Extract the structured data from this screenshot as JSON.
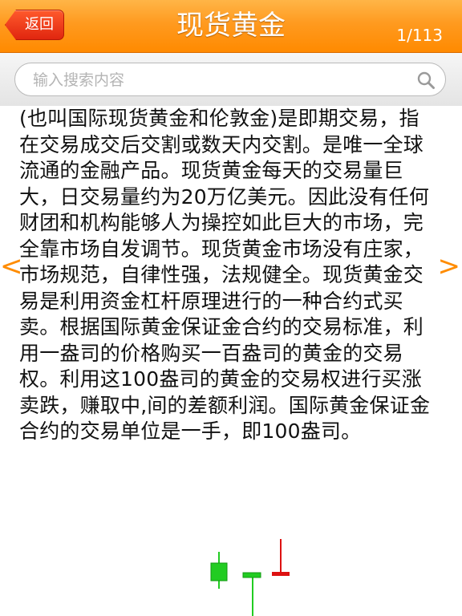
{
  "header": {
    "back_label": "返回",
    "title": "现货黄金",
    "page_counter": "1/113"
  },
  "search": {
    "placeholder": "输入搜索内容"
  },
  "content": {
    "article_text": "(也叫国际现货黄金和伦敦金)是即期交易，指在交易成交后交割或数天内交割。是唯一全球流通的金融产品。现货黄金每天的交易量巨大，日交易量约为20万亿美元。因此没有任何财团和机构能够人为操控如此巨大的市场，完全靠市场自发调节。现货黄金市场没有庄家，市场规范，自律性强，法规健全。现货黄金交易是利用资金杠杆原理进行的一种合约式买卖。根据国际黄金保证金合约的交易标准，利用一盎司的价格购买一百盎司的黄金的交易权。利用这100盎司的黄金的交易权进行买涨卖跌，赚取中,间的差额利润。国际黄金保证金合约的交易单位是一手，即100盎司。"
  },
  "nav": {
    "prev_glyph": "<",
    "next_glyph": ">"
  },
  "icons": {
    "search": "search-icon",
    "decoration": "candlestick-chart-icon"
  },
  "colors": {
    "header": "#ff9a1f",
    "back_button": "#e0260f",
    "nav_arrow": "#ff8c00",
    "candle_green": "#22cc22",
    "candle_red": "#dd1111"
  }
}
